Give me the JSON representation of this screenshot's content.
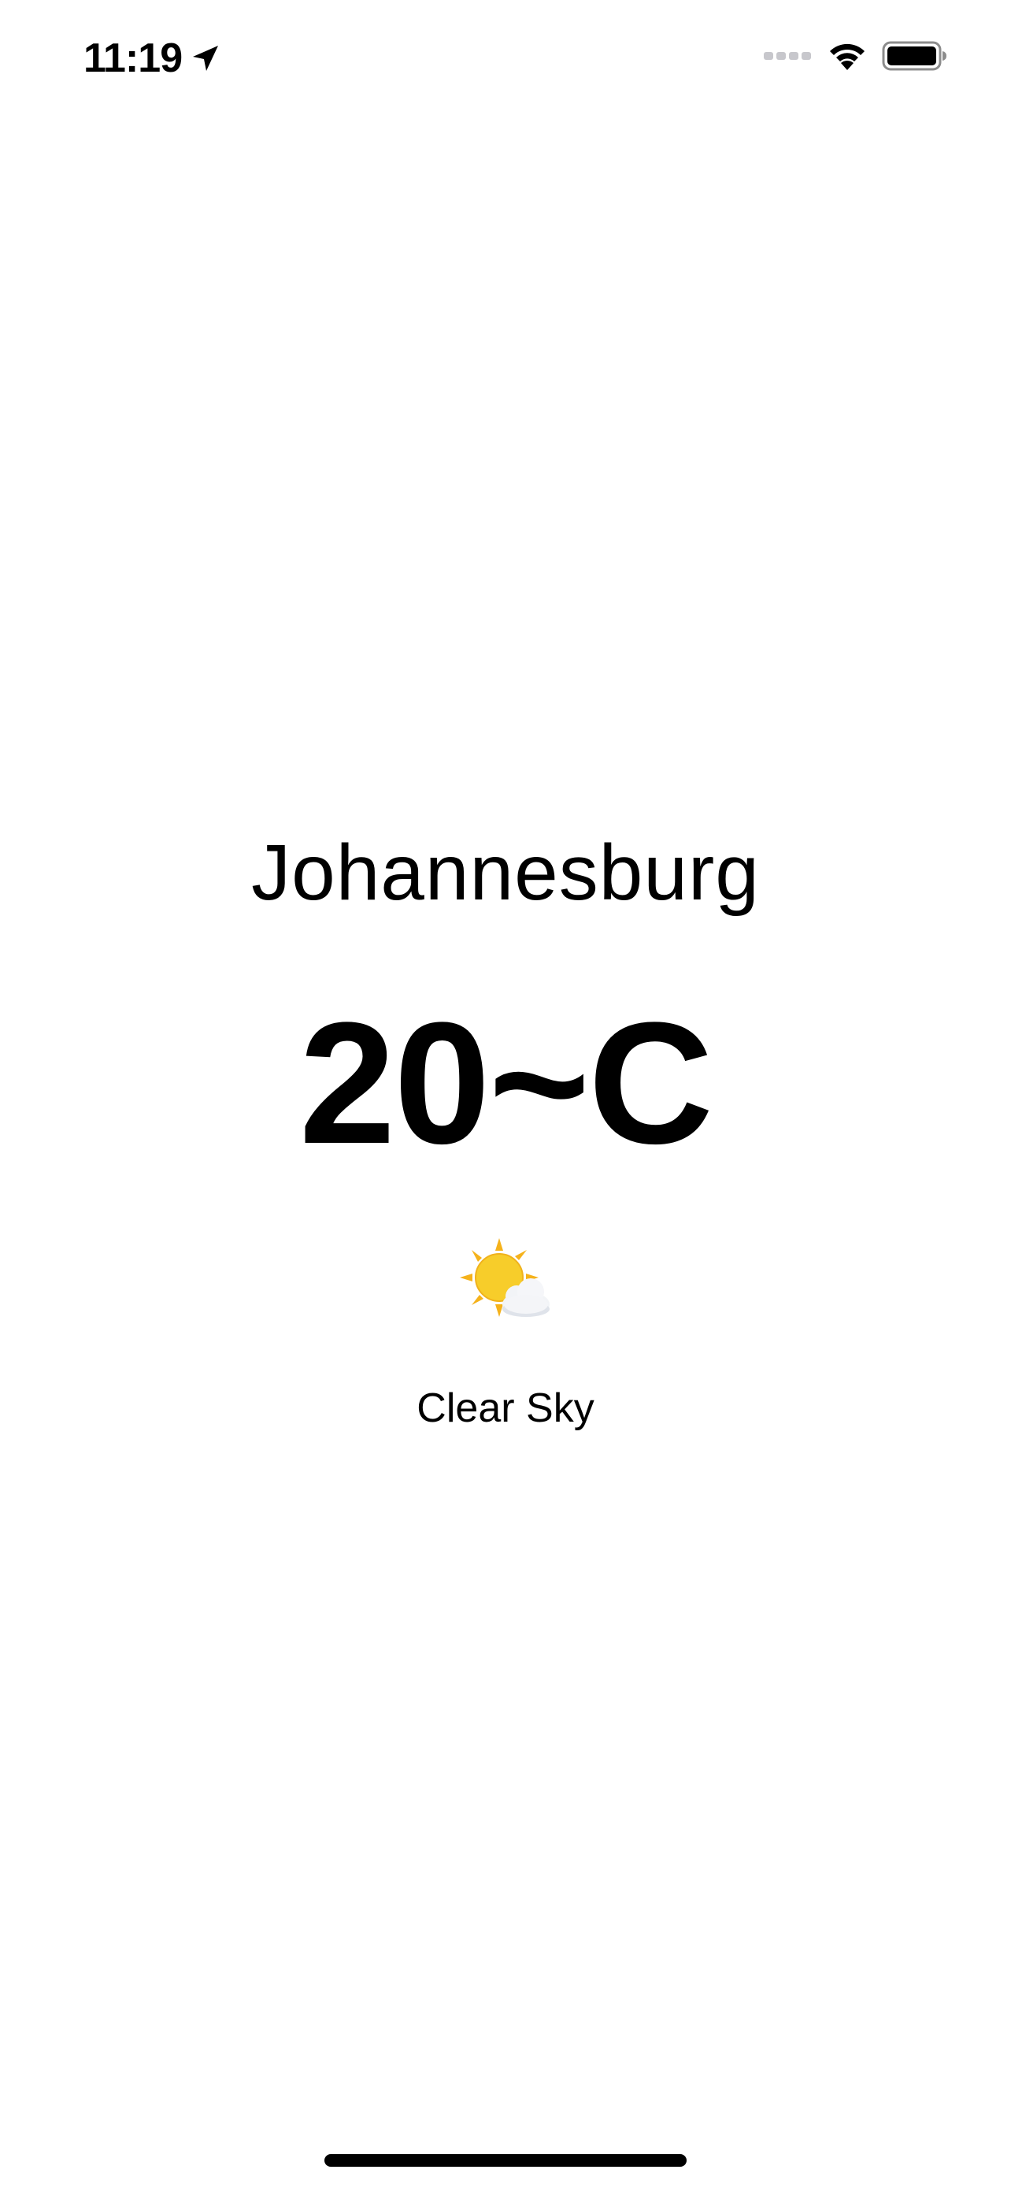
{
  "status_bar": {
    "time": "11:19",
    "location_icon": "location-arrow-icon",
    "signal_icon": "cellular-signal-icon",
    "wifi_icon": "wifi-icon",
    "battery_icon": "battery-icon"
  },
  "weather": {
    "city": "Johannesburg",
    "temperature": "20~C",
    "icon": "sun-behind-cloud-icon",
    "condition": "Clear Sky"
  },
  "colors": {
    "background": "#ffffff",
    "text": "#000000",
    "signal_inactive": "#c7c7cc",
    "sun": "#f5c21b",
    "cloud": "#f2f4f7"
  }
}
